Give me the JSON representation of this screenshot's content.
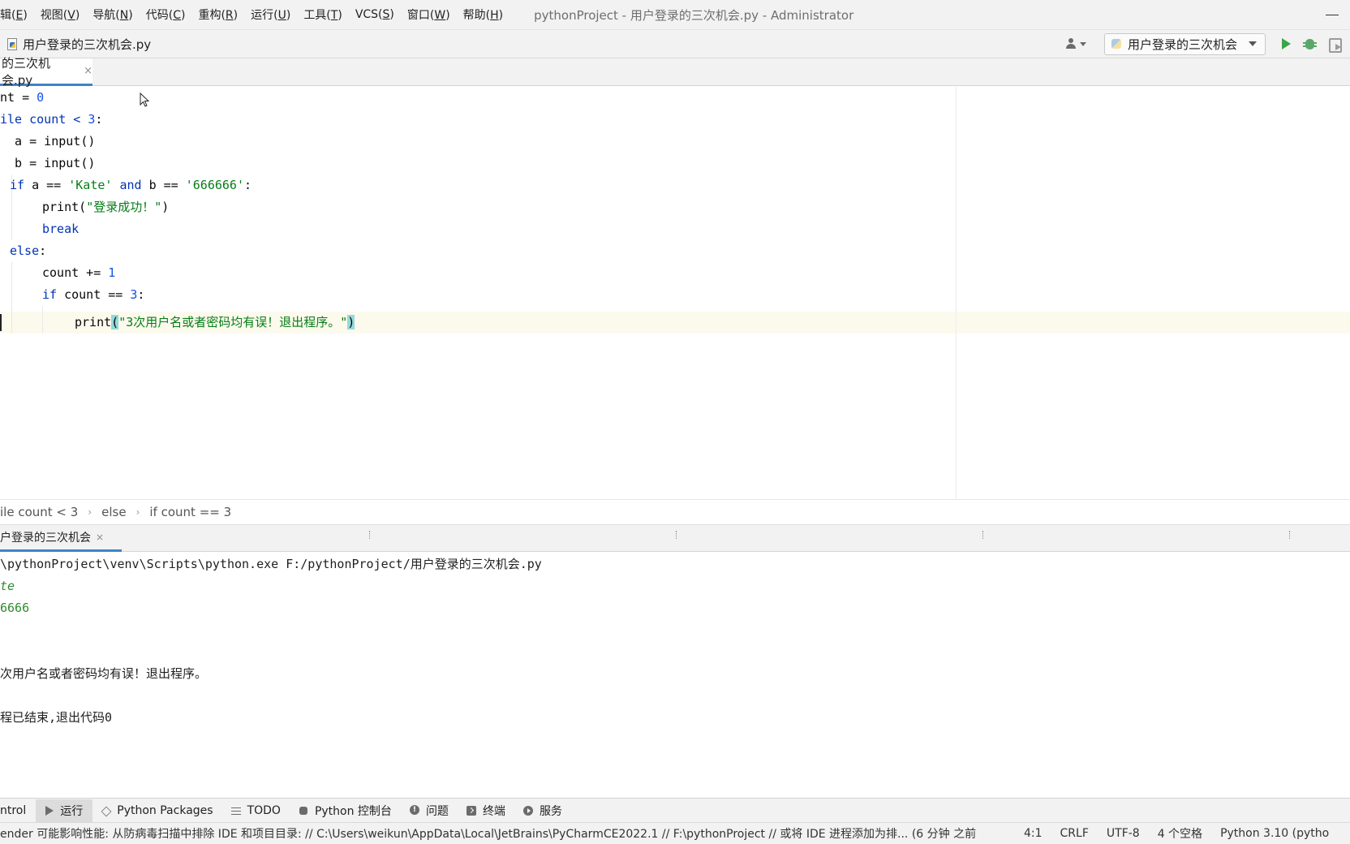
{
  "menu": {
    "items": [
      {
        "label": "辑(",
        "key": "E",
        "tail": ")"
      },
      {
        "label": "视图(",
        "key": "V",
        "tail": ")"
      },
      {
        "label": "导航(",
        "key": "N",
        "tail": ")"
      },
      {
        "label": "代码(",
        "key": "C",
        "tail": ")"
      },
      {
        "label": "重构(",
        "key": "R",
        "tail": ")"
      },
      {
        "label": "运行(",
        "key": "U",
        "tail": ")"
      },
      {
        "label": "工具(",
        "key": "T",
        "tail": ")"
      },
      {
        "label": "VCS(",
        "key": "S",
        "tail": ")"
      },
      {
        "label": "窗口(",
        "key": "W",
        "tail": ")"
      },
      {
        "label": "帮助(",
        "key": "H",
        "tail": ")"
      }
    ],
    "window_title": "pythonProject - 用户登录的三次机会.py - Administrator"
  },
  "navbar": {
    "file_name": "用户登录的三次机会.py",
    "run_config": "用户登录的三次机会",
    "icons": [
      "user-icon",
      "run-icon",
      "debug-icon",
      "coverage-icon"
    ]
  },
  "editor_tab": {
    "label": "的三次机会.py",
    "close": "×"
  },
  "code": {
    "line1": {
      "a": "nt = ",
      "b": "0"
    },
    "line2": {
      "a": "ile count < ",
      "b": "3",
      "c": ":"
    },
    "line3": "  a = input()",
    "line4": "  b = input()",
    "line5": {
      "kw1": "if",
      "a": " a == ",
      "s1": "'Kate'",
      "kw2": "and",
      "b": " b == ",
      "s2": "'666666'",
      "c": ":"
    },
    "line6": {
      "a": "print(",
      "s": "\"登录成功！\"",
      "b": ")"
    },
    "line7": "break",
    "line8": {
      "kw": "else",
      "c": ":"
    },
    "line9": {
      "a": "count += ",
      "n": "1"
    },
    "line10": {
      "kw": "if",
      "a": " count == ",
      "n": "3",
      "c": ":"
    },
    "line11": {
      "a": "print",
      "p1": "(",
      "s": "\"3次用户名或者密码均有误！退出程序。\"",
      "p2": ")"
    }
  },
  "breadcrumb": {
    "items": [
      "ile count < 3",
      "else",
      "if count == 3"
    ],
    "separator": "›"
  },
  "run_panel": {
    "tab_label": "户登录的三次机会",
    "close": "×"
  },
  "console": {
    "lines": [
      "\\pythonProject\\venv\\Scripts\\python.exe F:/pythonProject/用户登录的三次机会.py",
      "te",
      "6666",
      "",
      "",
      "次用户名或者密码均有误！退出程序。",
      "",
      "程已结束,退出代码0"
    ]
  },
  "tool_strip": {
    "items": [
      {
        "label": "ntrol",
        "icon": ""
      },
      {
        "label": "运行",
        "icon": "play-icon",
        "active": true
      },
      {
        "label": "Python Packages",
        "icon": "layers-icon"
      },
      {
        "label": "TODO",
        "icon": "list-icon"
      },
      {
        "label": "Python 控制台",
        "icon": "python-icon"
      },
      {
        "label": "问题",
        "icon": "info-icon"
      },
      {
        "label": "终端",
        "icon": "terminal-icon"
      },
      {
        "label": "服务",
        "icon": "services-icon"
      }
    ]
  },
  "status_bar": {
    "message": "ender 可能影响性能: 从防病毒扫描中排除 IDE 和项目目录: // C:\\Users\\weikun\\AppData\\Local\\JetBrains\\PyCharmCE2022.1 // F:\\pythonProject // 或将 IDE 进程添加为排... (6 分钟 之前",
    "position": "4:1",
    "line_sep": "CRLF",
    "encoding": "UTF-8",
    "indent": "4 个空格",
    "interpreter": "Python 3.10 (pytho"
  },
  "colors": {
    "keyword": "#0033b3",
    "number": "#1750eb",
    "string": "#067d17",
    "accent": "#4083c9",
    "run_green": "#3aa64a"
  }
}
